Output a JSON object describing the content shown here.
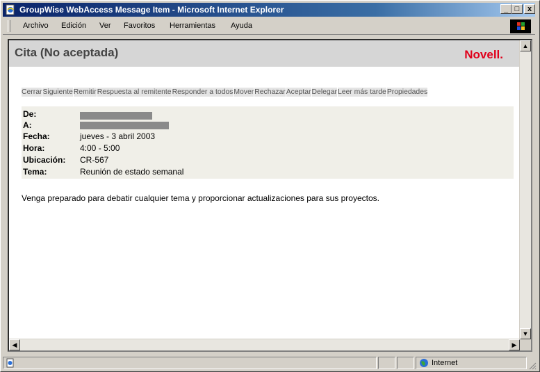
{
  "window": {
    "title": "GroupWise WebAccess Message Item - Microsoft Internet Explorer",
    "minimize": "_",
    "maximize": "□",
    "close": "x"
  },
  "menubar": [
    "Archivo",
    "Edición",
    "Ver",
    "Favoritos",
    "Herramientas",
    "Ayuda"
  ],
  "header": {
    "title": "Cita   (No aceptada)",
    "logo": "Novell."
  },
  "toolbar": [
    "Cerrar",
    "Siguiente",
    "Remitir",
    "Respuesta al remitente",
    "Responder a todos",
    "Mover",
    "Rechazar",
    "Aceptar",
    "Delegar",
    "Leer más tarde",
    "Propiedades"
  ],
  "fields": {
    "from_label": "De:",
    "to_label": "A:",
    "date_label": "Fecha:",
    "date_value": "jueves - 3 abril 2003",
    "time_label": "Hora:",
    "time_value": "4:00 - 5:00",
    "place_label": "Ubicación:",
    "place_value": "CR-567",
    "subject_label": "Tema:",
    "subject_value": "Reunión de estado semanal"
  },
  "message": "Venga preparado para debatir cualquier tema y proporcionar actualizaciones para sus proyectos.",
  "statusbar": {
    "zone": "Internet"
  },
  "colors": {
    "titlebar": "#0a246a",
    "logo": "#e0001b",
    "header_bg": "#d6d6d6"
  }
}
